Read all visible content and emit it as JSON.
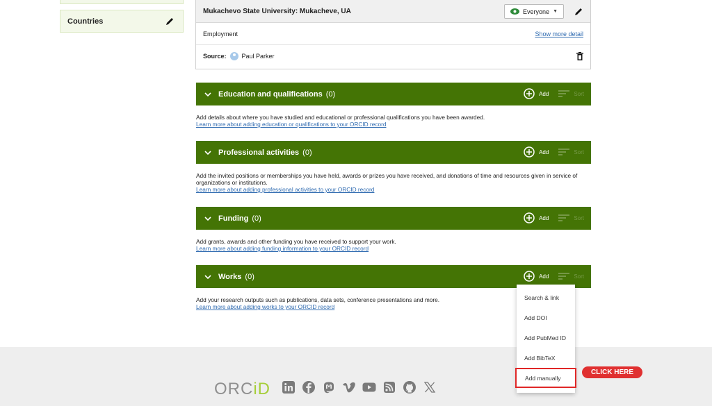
{
  "sidebar": {
    "countries_label": "Countries"
  },
  "employment": {
    "title": "Mukachevo State University: Mukacheve, UA",
    "visibility": "Everyone",
    "type": "Employment",
    "show_more": "Show more detail",
    "source_label": "Source:",
    "source_name": "Paul Parker"
  },
  "sections": [
    {
      "title": "Education and qualifications",
      "count": "(0)",
      "add": "Add",
      "sort": "Sort",
      "description": "Add details about where you have studied and educational or professional qualifications you have been awarded.",
      "link": "Learn more about adding education or qualifications to your ORCID record"
    },
    {
      "title": "Professional activities",
      "count": "(0)",
      "add": "Add",
      "sort": "Sort",
      "description": "Add the invited positions or memberships you have held, awards or prizes you have received, and donations of time and resources given in service of organizations or institutions.",
      "link": "Learn more about adding professional activities to your ORCID record"
    },
    {
      "title": "Funding",
      "count": "(0)",
      "add": "Add",
      "sort": "Sort",
      "description": "Add grants, awards and other funding you have received to support your work.",
      "link": "Learn more about adding funding information to your ORCID record"
    },
    {
      "title": "Works",
      "count": "(0)",
      "add": "Add",
      "sort": "Sort",
      "description": "Add your research outputs such as publications, data sets, conference presentations and more.",
      "link": "Learn more about adding works to your ORCID record"
    }
  ],
  "works_menu": [
    "Search & link",
    "Add DOI",
    "Add PubMed ID",
    "Add BibTeX",
    "Add manually"
  ],
  "annotation": "CLICK HERE",
  "footer": {
    "logo_main": "ORC",
    "logo_id": "iD",
    "socials": [
      "linkedin-icon",
      "facebook-icon",
      "mastodon-icon",
      "vimeo-icon",
      "youtube-icon",
      "rss-icon",
      "github-icon",
      "x-icon"
    ]
  },
  "colors": {
    "section_green": "#447405",
    "orcid_green": "#a6ce39",
    "highlight_red": "#e02727",
    "link_blue": "#2e6ab0"
  }
}
